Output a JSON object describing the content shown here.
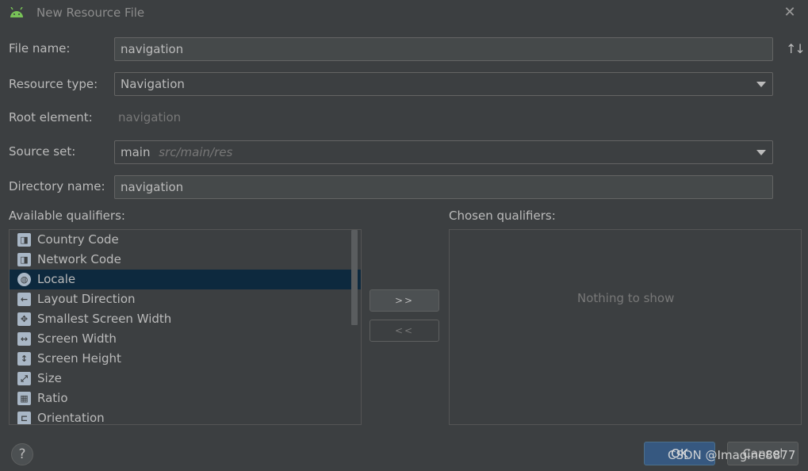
{
  "dialog": {
    "title": "New Resource File",
    "close_icon": "close-icon"
  },
  "form": {
    "file_name_label": "File name:",
    "file_name_value": "navigation",
    "resource_type_label": "Resource type:",
    "resource_type_value": "Navigation",
    "root_element_label": "Root element:",
    "root_element_value": "navigation",
    "source_set_label": "Source set:",
    "source_set_value": "main",
    "source_set_hint": "src/main/res",
    "directory_name_label": "Directory name:",
    "directory_name_value": "navigation"
  },
  "qualifiers": {
    "available_label": "Available qualifiers:",
    "chosen_label": "Chosen qualifiers:",
    "items": [
      {
        "label": "Country Code",
        "icon": "country-code-icon"
      },
      {
        "label": "Network Code",
        "icon": "network-code-icon"
      },
      {
        "label": "Locale",
        "icon": "globe-icon",
        "selected": true
      },
      {
        "label": "Layout Direction",
        "icon": "layout-direction-icon"
      },
      {
        "label": "Smallest Screen Width",
        "icon": "smallest-width-icon"
      },
      {
        "label": "Screen Width",
        "icon": "screen-width-icon"
      },
      {
        "label": "Screen Height",
        "icon": "screen-height-icon"
      },
      {
        "label": "Size",
        "icon": "size-icon"
      },
      {
        "label": "Ratio",
        "icon": "ratio-icon"
      },
      {
        "label": "Orientation",
        "icon": "orientation-icon"
      }
    ],
    "add_button": ">>",
    "remove_button": "<<",
    "empty_text": "Nothing to show"
  },
  "footer": {
    "help": "?",
    "ok": "OK",
    "cancel": "Cancel",
    "watermark": "CSDN @Imagine8877"
  },
  "colors": {
    "background": "#3c3f41",
    "selection": "#0d293e",
    "primary_button": "#365880"
  }
}
